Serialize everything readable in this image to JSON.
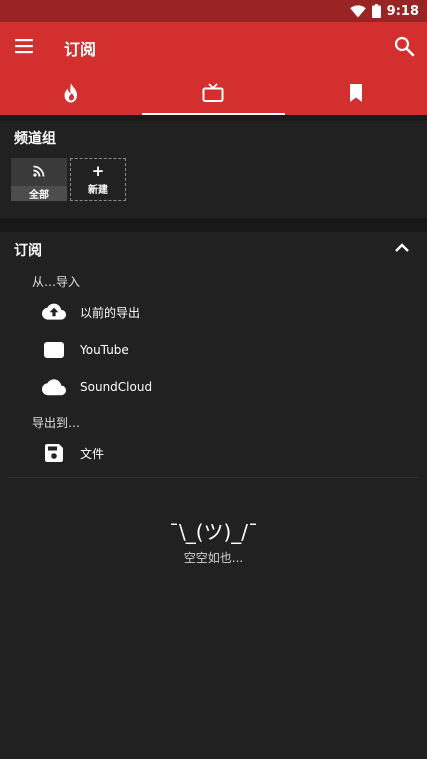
{
  "status_bar": {
    "time": "9:18",
    "wifi_icon": "wifi-icon",
    "battery_icon": "battery-icon"
  },
  "app_bar": {
    "title": "订阅",
    "menu_icon": "hamburger-menu-icon",
    "search_icon": "search-icon",
    "color": "#d32f2f"
  },
  "tabs": [
    {
      "icon": "fire-icon",
      "selected": false
    },
    {
      "icon": "tv-icon",
      "selected": true
    },
    {
      "icon": "bookmark-icon",
      "selected": false
    }
  ],
  "channel_groups": {
    "title": "频道组",
    "items": [
      {
        "label": "全部",
        "icon": "rss-icon"
      },
      {
        "label": "新建",
        "icon": "plus-icon",
        "symbol": "+"
      }
    ]
  },
  "subscriptions": {
    "title": "订阅",
    "collapse_icon": "chevron-up-icon",
    "import_from_label": "从…导入",
    "import_items": [
      {
        "label": "以前的导出",
        "icon": "cloud-upload-icon"
      },
      {
        "label": "YouTube",
        "icon": "youtube-icon"
      },
      {
        "label": "SoundCloud",
        "icon": "cloud-icon"
      }
    ],
    "export_to_label": "导出到…",
    "export_items": [
      {
        "label": "文件",
        "icon": "save-icon"
      }
    ]
  },
  "empty_state": {
    "kaomoji": "¯\\_(ツ)_/¯",
    "message": "空空如也..."
  }
}
